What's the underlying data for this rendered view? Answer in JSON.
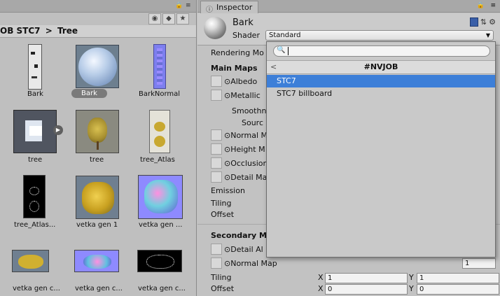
{
  "project": {
    "breadcrumb": {
      "parent": "OB STC7",
      "separator": ">",
      "current": "Tree"
    },
    "items": [
      {
        "name": "Bark",
        "selected": false,
        "icon": "bark-texture-thumb"
      },
      {
        "name": "Bark",
        "selected": true,
        "icon": "material-sphere-thumb"
      },
      {
        "name": "BarkNormal",
        "selected": false,
        "icon": "normal-map-thumb"
      },
      {
        "name": "tree",
        "selected": false,
        "icon": "prefab-thumb"
      },
      {
        "name": "tree",
        "selected": false,
        "icon": "tree-mesh-thumb"
      },
      {
        "name": "tree_Atlas",
        "selected": false,
        "icon": "atlas-thumb"
      },
      {
        "name": "tree_Atlas...",
        "selected": false,
        "icon": "atlas-alpha-thumb"
      },
      {
        "name": "vetka gen 1",
        "selected": false,
        "icon": "branch-thumb"
      },
      {
        "name": "vetka gen ...",
        "selected": false,
        "icon": "branch-normal-thumb"
      },
      {
        "name": "vetka gen c...",
        "selected": false,
        "icon": "branch-thumb"
      },
      {
        "name": "vetka gen c...",
        "selected": false,
        "icon": "branch-normal-thumb"
      },
      {
        "name": "vetka gen c...",
        "selected": false,
        "icon": "branch-alpha-thumb"
      }
    ]
  },
  "inspector": {
    "tab_label": "Inspector",
    "material_name": "Bark",
    "shader_label": "Shader",
    "shader_value": "Standard",
    "fields": {
      "rendering_mode": "Rendering Mo",
      "main_maps": "Main Maps",
      "albedo": "Albedo",
      "metallic": "Metallic",
      "smoothness": "Smoothn",
      "source": "Sourc",
      "normal_map": "Normal M",
      "height_map": "Height M",
      "occlusion": "Occlusion",
      "detail_mask": "Detail Ma",
      "emission": "Emission",
      "tiling": "Tiling",
      "offset": "Offset",
      "secondary_maps": "Secondary M",
      "detail_albedo": "Detail Al",
      "normal_map_2": "Normal Map",
      "normal_map_2_value": "1",
      "tiling_2": "Tiling",
      "offset_2": "Offset",
      "tiling_x": "1",
      "tiling_y": "1",
      "offset_x": "0",
      "offset_y": "0",
      "x_label": "X",
      "y_label": "Y"
    }
  },
  "shader_popup": {
    "search_value": "",
    "category": "#NVJOB",
    "back_glyph": "<",
    "items": [
      {
        "label": "STC7",
        "selected": true
      },
      {
        "label": "STC7 billboard",
        "selected": false
      }
    ]
  }
}
